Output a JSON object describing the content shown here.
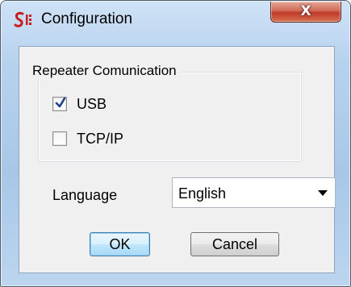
{
  "window": {
    "title": "Configuration",
    "icon": "app-logo-icon",
    "close_label": "X"
  },
  "group": {
    "legend": "Repeater Comunication",
    "options": [
      {
        "label": "USB",
        "checked": true
      },
      {
        "label": "TCP/IP",
        "checked": false
      }
    ]
  },
  "language": {
    "label": "Language",
    "selected": "English"
  },
  "buttons": {
    "ok": "OK",
    "cancel": "Cancel"
  },
  "colors": {
    "titlebar": "#b7d2ee",
    "close_button": "#c0392b",
    "checkmark": "#1f3f8f",
    "default_button_border": "#3c7fb1"
  }
}
